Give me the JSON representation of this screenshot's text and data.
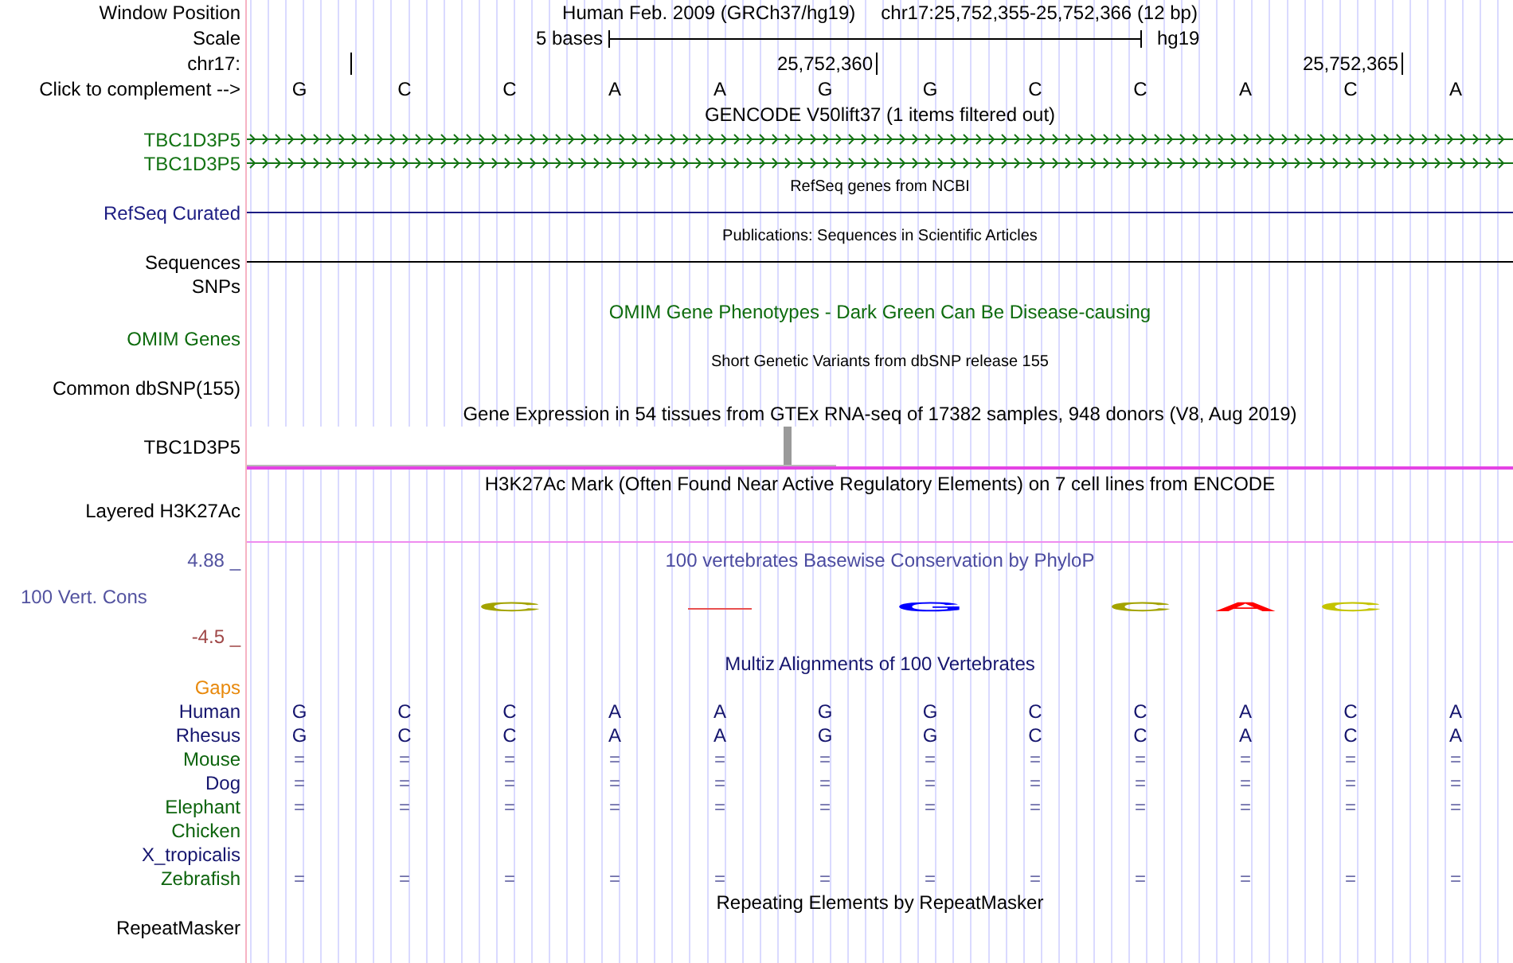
{
  "header": {
    "label": "Window Position",
    "assembly": "Human Feb. 2009 (GRCh37/hg19)",
    "range": "chr17:25,752,355-25,752,366 (12 bp)"
  },
  "scale": {
    "label": "Scale",
    "span": "5 bases",
    "assembly": "hg19"
  },
  "ruler": {
    "label": "chr17:",
    "ticks": [
      "25,752,360",
      "25,752,365"
    ]
  },
  "sequence": {
    "label": "Click to complement -->",
    "bases": [
      "G",
      "C",
      "C",
      "A",
      "A",
      "G",
      "G",
      "C",
      "C",
      "A",
      "C",
      "A"
    ]
  },
  "tracks": [
    {
      "kind": "gencode",
      "title": "GENCODE V50lift37 (1 items filtered out)",
      "items": [
        {
          "label": "TBC1D3P5",
          "kind": "arrows"
        },
        {
          "label": "TBC1D3P5",
          "kind": "arrows"
        }
      ]
    },
    {
      "kind": "refseq",
      "title": "RefSeq genes from NCBI",
      "items": [
        {
          "label": "RefSeq Curated",
          "kind": "line"
        }
      ]
    },
    {
      "kind": "pubs",
      "title": "Publications: Sequences in Scientific Articles",
      "items": [
        {
          "label": "Sequences",
          "kind": "line"
        },
        {
          "label": "SNPs",
          "kind": "none"
        }
      ]
    },
    {
      "kind": "omim",
      "title": "OMIM Gene Phenotypes - Dark Green Can Be Disease-causing",
      "items": [
        {
          "label": "OMIM Genes",
          "kind": "none"
        }
      ]
    },
    {
      "kind": "dbsnp",
      "title": "Short Genetic Variants from dbSNP release 155",
      "items": [
        {
          "label": "Common dbSNP(155)",
          "kind": "none"
        }
      ]
    },
    {
      "kind": "gtex",
      "title": "Gene Expression in 54 tissues from GTEx RNA-seq of 17382 samples, 948 donors (V8, Aug 2019)",
      "items": [
        {
          "label": "TBC1D3P5",
          "kind": "barchart"
        }
      ]
    },
    {
      "kind": "encode",
      "title": "H3K27Ac Mark (Often Found Near Active Regulatory Elements) on 7 cell lines from ENCODE",
      "items": [
        {
          "label": "Layered H3K27Ac",
          "kind": "none"
        }
      ]
    },
    {
      "kind": "phylop",
      "title": "100 vertebrates Basewise Conservation by PhyloP",
      "label": "100 Vert. Cons",
      "max": "4.88 _",
      "min": "-4.5 _",
      "logo": [
        {
          "kind": "blank"
        },
        {
          "kind": "blank"
        },
        {
          "kind": "letter",
          "letter": "C",
          "color": "#a3a300"
        },
        {
          "kind": "blank"
        },
        {
          "kind": "mark",
          "color": "#e85050"
        },
        {
          "kind": "blank"
        },
        {
          "kind": "letter",
          "letter": "G",
          "color": "#0000ff"
        },
        {
          "kind": "blank"
        },
        {
          "kind": "letter",
          "letter": "C",
          "color": "#a3a300"
        },
        {
          "kind": "letter",
          "letter": "A",
          "color": "#ff0000"
        },
        {
          "kind": "letter",
          "letter": "C",
          "color": "#c4c400"
        },
        {
          "kind": "blank"
        }
      ]
    },
    {
      "kind": "multiz",
      "title": "Multiz Alignments of 100 Vertebrates",
      "species": [
        {
          "name": "Gaps",
          "kind": "empty",
          "color": "#e8890c"
        },
        {
          "name": "Human",
          "kind": "sequence",
          "color": "#15156e",
          "bases": [
            "G",
            "C",
            "C",
            "A",
            "A",
            "G",
            "G",
            "C",
            "C",
            "A",
            "C",
            "A"
          ]
        },
        {
          "name": "Rhesus",
          "kind": "sequence",
          "color": "#15156e",
          "bases": [
            "G",
            "C",
            "C",
            "A",
            "A",
            "G",
            "G",
            "C",
            "C",
            "A",
            "C",
            "A"
          ]
        },
        {
          "name": "Mouse",
          "kind": "match",
          "color": "#0d640d",
          "bases": [
            "=",
            "=",
            "=",
            "=",
            "=",
            "=",
            "=",
            "=",
            "=",
            "=",
            "=",
            "="
          ]
        },
        {
          "name": "Dog",
          "kind": "match",
          "color": "#15156e",
          "bases": [
            "=",
            "=",
            "=",
            "=",
            "=",
            "=",
            "=",
            "=",
            "=",
            "=",
            "=",
            "="
          ]
        },
        {
          "name": "Elephant",
          "kind": "match",
          "color": "#0d640d",
          "bases": [
            "=",
            "=",
            "=",
            "=",
            "=",
            "=",
            "=",
            "=",
            "=",
            "=",
            "=",
            "="
          ]
        },
        {
          "name": "Chicken",
          "kind": "empty",
          "color": "#0d640d"
        },
        {
          "name": "X_tropicalis",
          "kind": "empty",
          "color": "#15156e"
        },
        {
          "name": "Zebrafish",
          "kind": "match",
          "color": "#0d640d",
          "bases": [
            "=",
            "=",
            "=",
            "=",
            "=",
            "=",
            "=",
            "=",
            "=",
            "=",
            "=",
            "="
          ]
        }
      ]
    },
    {
      "kind": "rmsk",
      "title": "Repeating Elements by RepeatMasker",
      "items": [
        {
          "label": "RepeatMasker",
          "kind": "none"
        }
      ]
    }
  ]
}
